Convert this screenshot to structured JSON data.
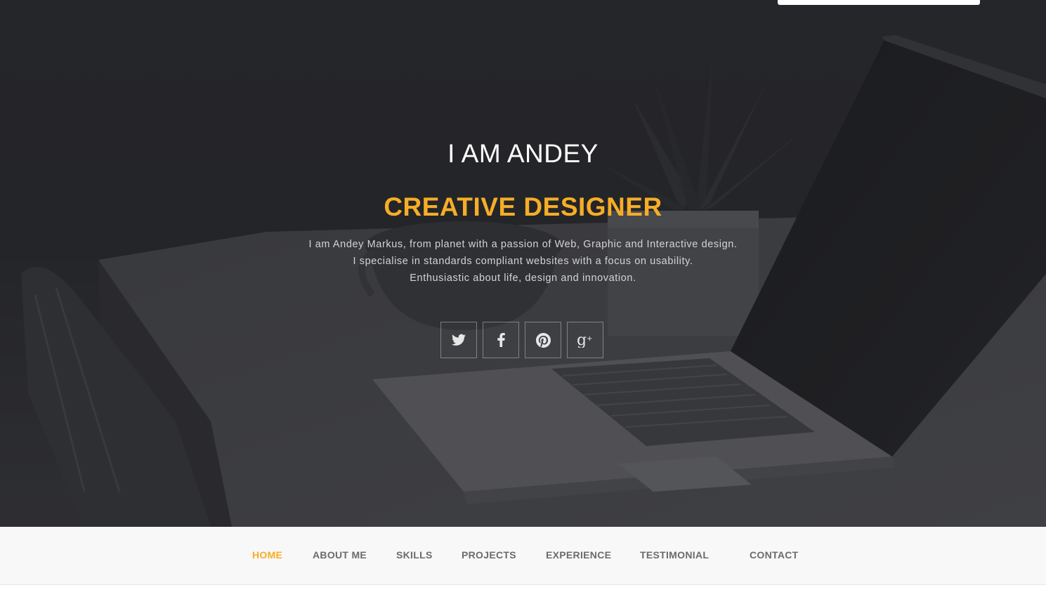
{
  "hero": {
    "title": "I AM ANDEY",
    "subtitle": "CREATIVE DESIGNER",
    "description": [
      "I am Andey Markus, from planet with a passion of Web, Graphic and Interactive design.",
      "I specialise in standards compliant websites with a focus on usability.",
      "Enthusiastic about life, design and innovation."
    ],
    "background_image": "desk-laptop-plant-photo"
  },
  "socials": [
    {
      "icon": "twitter-icon"
    },
    {
      "icon": "facebook-icon"
    },
    {
      "icon": "pinterest-icon"
    },
    {
      "icon": "google-plus-icon"
    }
  ],
  "nav": {
    "items": [
      {
        "label": "HOME",
        "active": true
      },
      {
        "label": "ABOUT ME",
        "active": false
      },
      {
        "label": "SKILLS",
        "active": false
      },
      {
        "label": "PROJECTS",
        "active": false
      },
      {
        "label": "EXPERIENCE",
        "active": false
      },
      {
        "label": "TESTIMONIAL",
        "active": false
      },
      {
        "label": "CONTACT",
        "active": false
      }
    ]
  },
  "colors": {
    "accent": "#f6ad27",
    "hero_bg": "#2a2b2e",
    "nav_bg": "#f8f8f8",
    "nav_text": "#6b6b6b",
    "title_text": "#ffffff",
    "body_text": "#d4d4d4"
  }
}
